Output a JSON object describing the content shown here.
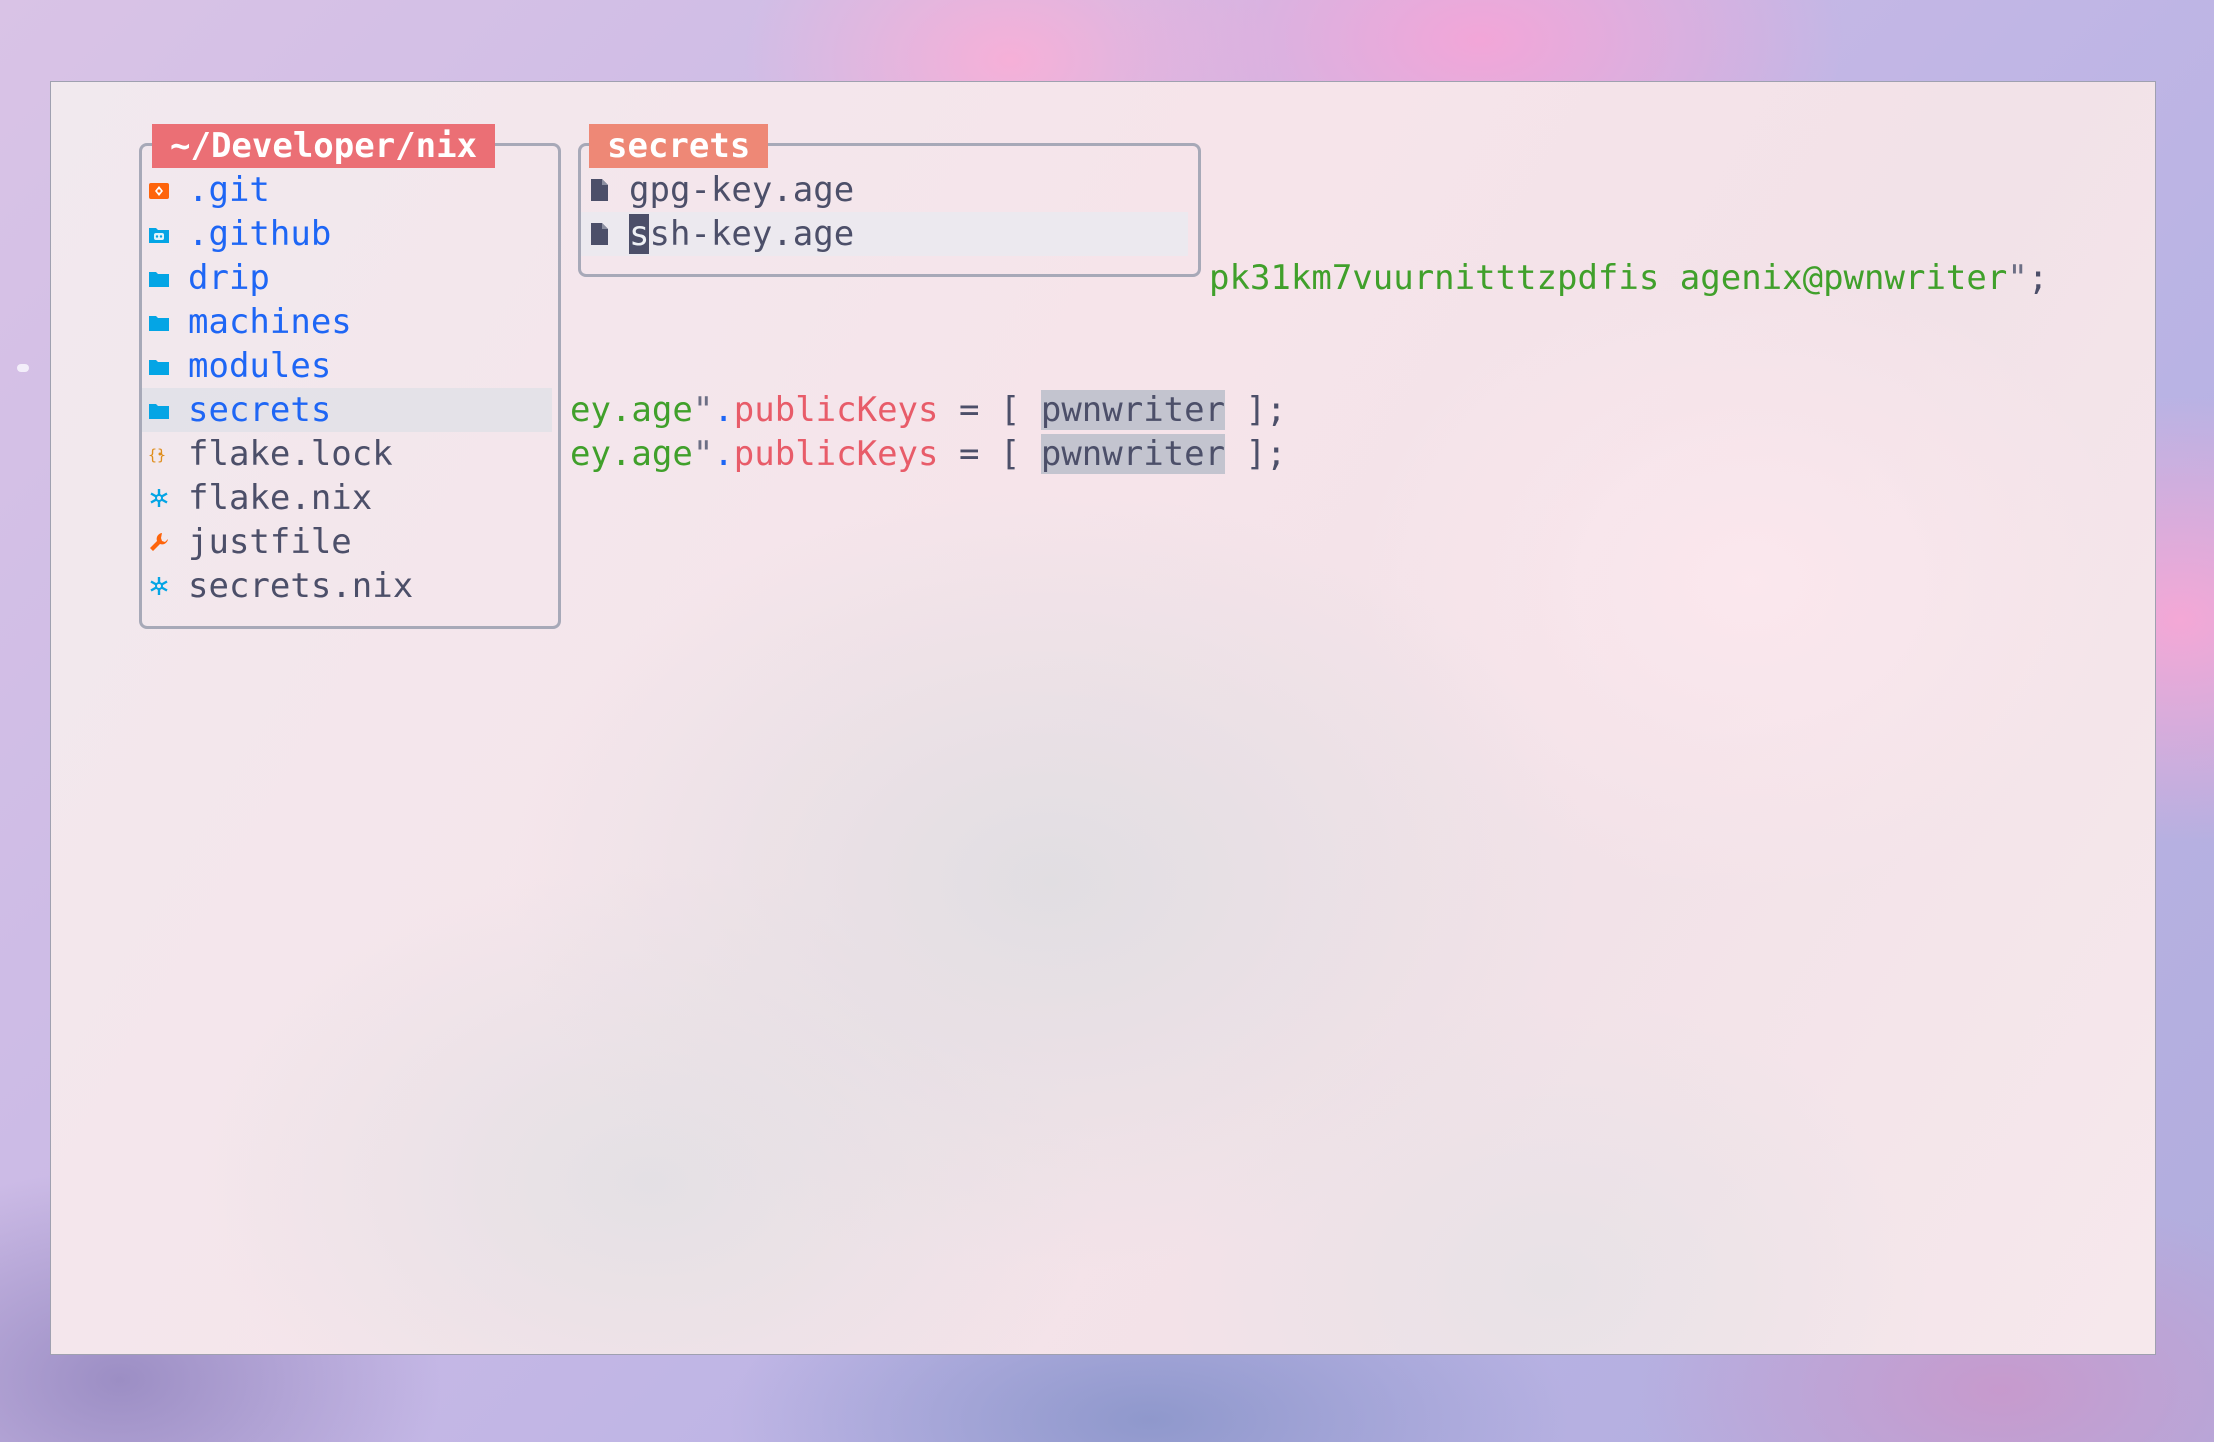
{
  "left_panel": {
    "title": "~/Developer/nix",
    "items": [
      {
        "name": ".git",
        "kind": "dir",
        "icon": "git-folder-icon",
        "icon_color": "#fe640b"
      },
      {
        "name": ".github",
        "kind": "dir",
        "icon": "github-folder-icon",
        "icon_color": "#04a5e5"
      },
      {
        "name": "drip",
        "kind": "dir",
        "icon": "folder-icon",
        "icon_color": "#04a5e5"
      },
      {
        "name": "machines",
        "kind": "dir",
        "icon": "folder-icon",
        "icon_color": "#04a5e5"
      },
      {
        "name": "modules",
        "kind": "dir",
        "icon": "folder-icon",
        "icon_color": "#04a5e5"
      },
      {
        "name": "secrets",
        "kind": "dir",
        "icon": "folder-icon",
        "icon_color": "#04a5e5",
        "selected": true
      },
      {
        "name": "flake.lock",
        "kind": "file",
        "icon": "json-braces-icon",
        "icon_color": "#df8e1d"
      },
      {
        "name": "flake.nix",
        "kind": "file",
        "icon": "nix-snowflake-icon",
        "icon_color": "#04a5e5"
      },
      {
        "name": "justfile",
        "kind": "file",
        "icon": "wrench-icon",
        "icon_color": "#fe640b"
      },
      {
        "name": "secrets.nix",
        "kind": "file",
        "icon": "nix-snowflake-icon",
        "icon_color": "#04a5e5"
      }
    ]
  },
  "right_panel": {
    "title": "secrets",
    "items": [
      {
        "name": "gpg-key.age",
        "icon": "file-icon"
      },
      {
        "name": "ssh-key.age",
        "icon": "file-icon",
        "selected": true,
        "cursor_char": "s",
        "rest": "sh-key.age"
      }
    ]
  },
  "code": {
    "line1": {
      "value": "pk31km7vuurnitttzpdfis agenix@pwnwriter",
      "close_quote": "\"",
      "semi": ";"
    },
    "line2": {
      "key": "ey.age",
      "quote": "\"",
      "dot": ".",
      "attr": "publicKeys",
      "eq": " = [ ",
      "host": "pwnwriter",
      "end": " ];"
    },
    "line3": {
      "key": "ey.age",
      "quote": "\"",
      "dot": ".",
      "attr": "publicKeys",
      "eq": " = [ ",
      "host": "pwnwriter",
      "end": " ];"
    }
  },
  "colors": {
    "left_title_bg": "#eb6f75",
    "right_title_bg": "#ee8876",
    "directory_text": "#1e66f5",
    "file_text": "#4c4f69",
    "string_green": "#40a02b"
  }
}
